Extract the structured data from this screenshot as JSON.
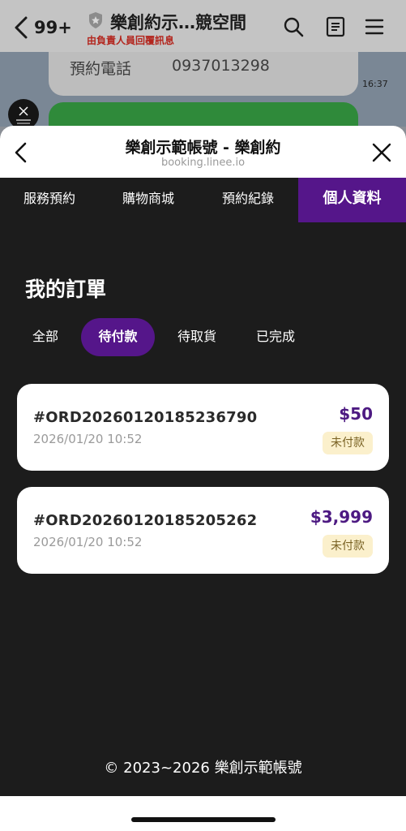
{
  "chat_header": {
    "unread_count": "99+",
    "title": "樂創約示…競空間",
    "subtitle": "由負責人員回覆訊息"
  },
  "chat": {
    "phone_label": "預約電話",
    "phone_value": "0937013298",
    "time": "16:37"
  },
  "webview": {
    "title": "樂創示範帳號 - 樂創約",
    "url": "booking.linee.io"
  },
  "tabs": [
    {
      "label": "服務預約",
      "active": false
    },
    {
      "label": "購物商城",
      "active": false
    },
    {
      "label": "預約紀錄",
      "active": false
    },
    {
      "label": "個人資料",
      "active": true
    }
  ],
  "page_title": "我的訂單",
  "filters": [
    {
      "label": "全部",
      "active": false
    },
    {
      "label": "待付款",
      "active": true
    },
    {
      "label": "待取貨",
      "active": false
    },
    {
      "label": "已完成",
      "active": false
    }
  ],
  "orders": [
    {
      "number": "#ORD20260120185236790",
      "date": "2026/01/20 10:52",
      "price": "$50",
      "status": "未付款"
    },
    {
      "number": "#ORD20260120185205262",
      "date": "2026/01/20 10:52",
      "price": "$3,999",
      "status": "未付款"
    }
  ],
  "footer": "© 2023~2026 樂創示範帳號",
  "colors": {
    "accent": "#55168a",
    "price": "#4d1a82",
    "badge_bg": "#fbf0cc",
    "badge_text": "#7a6324",
    "background": "#1c1c1c"
  }
}
